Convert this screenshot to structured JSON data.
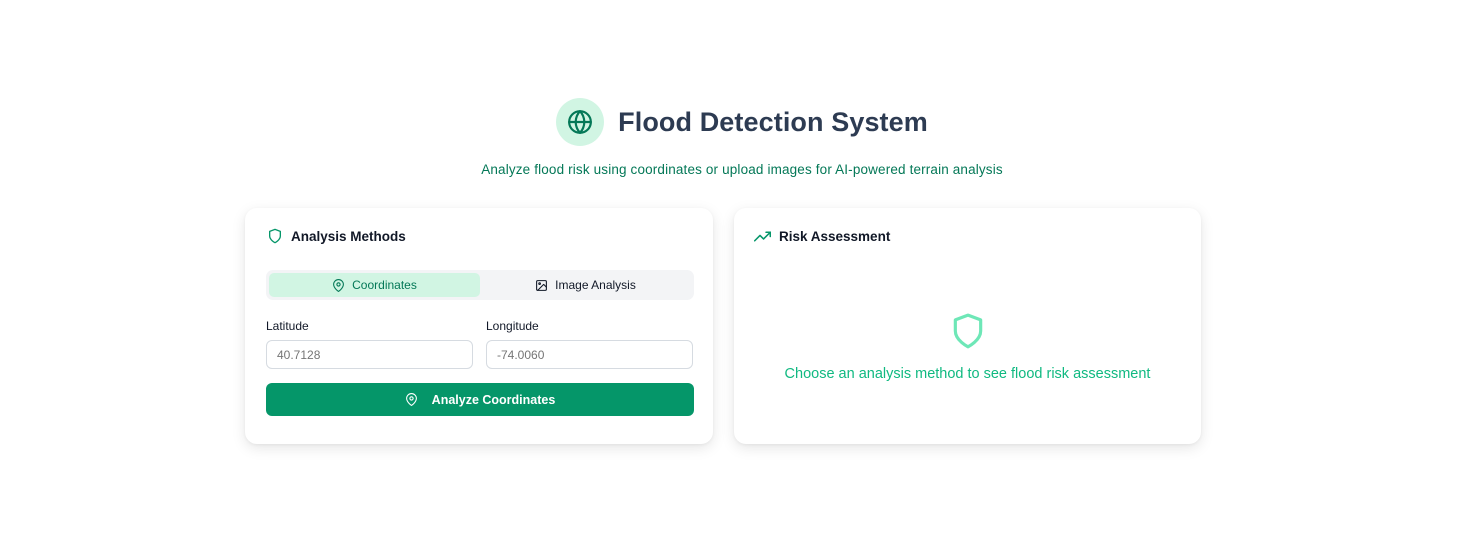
{
  "header": {
    "title": "Flood Detection System",
    "subtitle": "Analyze flood risk using coordinates or upload images for AI-powered terrain analysis",
    "icon": "globe-icon"
  },
  "analysis_card": {
    "title": "Analysis Methods",
    "icon": "shield-icon",
    "tabs": [
      {
        "label": "Coordinates",
        "icon": "map-pin-icon",
        "active": true
      },
      {
        "label": "Image Analysis",
        "icon": "image-icon",
        "active": false
      }
    ],
    "latitude": {
      "label": "Latitude",
      "placeholder": "40.7128",
      "value": ""
    },
    "longitude": {
      "label": "Longitude",
      "placeholder": "-74.0060",
      "value": ""
    },
    "submit": {
      "label": "Analyze Coordinates",
      "icon": "map-pin-icon"
    }
  },
  "risk_card": {
    "title": "Risk Assessment",
    "icon": "trending-up-icon",
    "empty_icon": "shield-icon",
    "empty_message": "Choose an analysis method to see flood risk assessment"
  },
  "colors": {
    "accent": "#059669",
    "accent_dark": "#047857",
    "accent_light": "#d1f5e3",
    "accent_soft": "#10b981",
    "title": "#2d3b52"
  }
}
